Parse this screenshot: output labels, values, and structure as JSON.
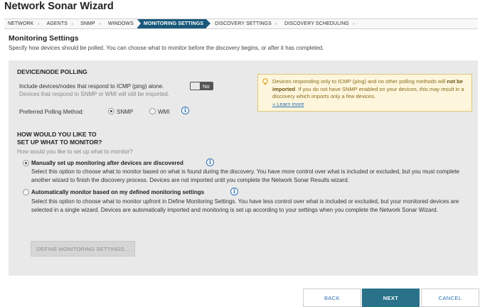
{
  "title": "Network Sonar Wizard",
  "steps": [
    "NETWORK",
    "AGENTS",
    "SNMP",
    "WINDOWS",
    "MONITORING SETTINGS",
    "DISCOVERY SETTINGS",
    "DISCOVERY SCHEDULING"
  ],
  "active_step": "MONITORING SETTINGS",
  "section": {
    "title": "Monitoring Settings",
    "description": "Specify how devices should be polled. You can choose what to monitor before the discovery begins, or after it has completed."
  },
  "polling": {
    "heading": "DEVICE/NODE POLLING",
    "icmp_label": "Include devices/nodes that respond to ICMP (ping) alone.",
    "icmp_sub": "Devices that respond to SNMP or WMI will still be imported.",
    "toggle_label": "No",
    "method_label": "Preferred Polling Method:",
    "options": [
      "SNMP",
      "WMI"
    ],
    "selected": "SNMP"
  },
  "note": {
    "text_before": "Devices responding only to ICMP (ping) and no other polling methods will",
    "bold": "not be imported",
    "text_after": ". If you do not have SNMP enabled on your devices, this may result in a discovery which imports only a few devices.",
    "link": "» Learn more",
    "accent_color": "#e1c878"
  },
  "setup": {
    "heading_line1": "HOW WOULD YOU LIKE TO",
    "heading_line2": "SET UP WHAT TO MONITOR?",
    "subheading": "How would you like to set up what to monitor?",
    "option1_label": "Manually set up monitoring after devices are discovered",
    "option1_desc": "Select this option to choose what to monitor based on what is found during the discovery. You have more control over what is included or excluded, but you must complete another wizard to finish the discovery process. Devices are not imported until you complete the Network Sonar Results wizard.",
    "option2_label": "Automatically monitor based on my defined monitoring settings",
    "option2_desc": "Select this option to choose what to monitor upfront in Define Monitoring Settings. You have less control over what is included or excluded, but your monitored devices are selected in a single wizard. Devices are automatically imported and monitoring is set up according to your settings when you complete the Network Sonar Wizard.",
    "selected_option": 1,
    "define_button": "DEFINE MONITORING SETTINGS..."
  },
  "footer": {
    "back": "BACK",
    "next": "NEXT",
    "cancel": "CANCEL",
    "primary_color": "#2a7289"
  }
}
